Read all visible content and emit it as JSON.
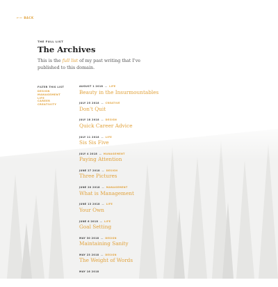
{
  "nav": {
    "back_label": "BACK",
    "back_arrow": "←—"
  },
  "header": {
    "eyebrow": "THE FULL LIST",
    "title": "The Archives",
    "intro_before": "This is the ",
    "intro_emphasis": "full list",
    "intro_after": " of my past writing that I've published to this domain."
  },
  "filters": {
    "heading": "FILTER THIS LIST",
    "items": [
      "DESIGN",
      "MANAGEMENT",
      "LIFE",
      "CAREER",
      "CREATIVITY"
    ]
  },
  "entries": [
    {
      "date": "AUGUST 1 2018",
      "category": "LIFE",
      "title": "Beauty in the Insurmountables"
    },
    {
      "date": "JULY 25 2018",
      "category": "CREATIVE",
      "title": "Don't Quit"
    },
    {
      "date": "JULY 18 2018",
      "category": "DESIGN",
      "title": "Quick Career Advice"
    },
    {
      "date": "JULY 11 2018",
      "category": "LIFE",
      "title": "Sis Sis Five"
    },
    {
      "date": "JULY 4 2018",
      "category": "MANAGEMENT",
      "title": "Paying Attention"
    },
    {
      "date": "JUNE 27 2018",
      "category": "DESIGN",
      "title": "Three Pictures"
    },
    {
      "date": "JUNE 20 2018",
      "category": "MANAGEMENT",
      "title": "What is Management"
    },
    {
      "date": "JUNE 13 2018",
      "category": "LIFE",
      "title": "Your Own"
    },
    {
      "date": "JUNE 6 2018",
      "category": "LIFE",
      "title": "Goal Setting"
    },
    {
      "date": "MAY 30 2018",
      "category": "DESIGN",
      "title": "Maintaining Sanity"
    },
    {
      "date": "MAY 23 2018",
      "category": "DESIGN",
      "title": "The Weight of Words"
    },
    {
      "date": "MAY 16 2018",
      "category": "",
      "title": ""
    }
  ],
  "colors": {
    "accent": "#e1a23c",
    "text": "#2e2e2e",
    "background": "#ffffff"
  }
}
